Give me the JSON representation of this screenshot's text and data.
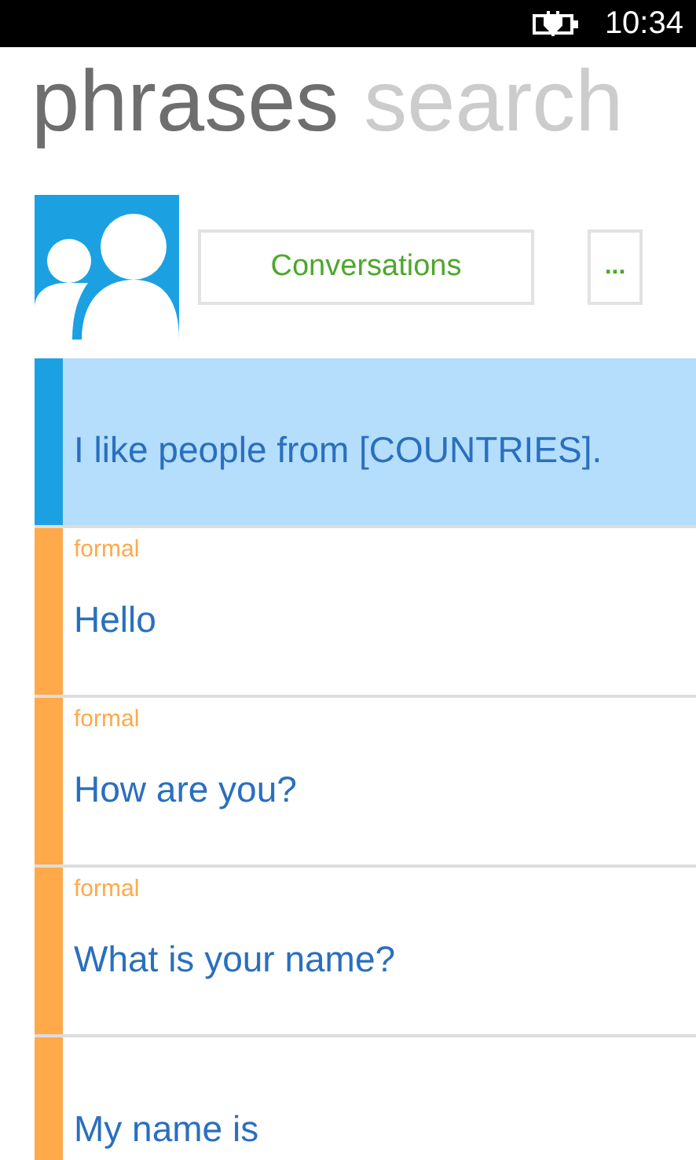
{
  "status_bar": {
    "time": "10:34"
  },
  "pivot": [
    {
      "label": "phrases",
      "selected": true
    },
    {
      "label": "search",
      "selected": false
    }
  ],
  "buttons": {
    "conversations": "Conversations",
    "more": "..."
  },
  "phrases": [
    {
      "text": "I like people from [COUNTRIES].",
      "selected": true,
      "color": "#1ba1e2"
    },
    {
      "tag": "formal",
      "text": "Hello",
      "selected": false,
      "color": "#ffa94a"
    },
    {
      "tag": "formal",
      "text": "How are you?",
      "selected": false,
      "color": "#ffa94a"
    },
    {
      "tag": "formal",
      "text": "What is your name?",
      "selected": false,
      "color": "#ffa94a"
    },
    {
      "text": "My name is",
      "selected": false,
      "color": "#ffa94a"
    }
  ]
}
